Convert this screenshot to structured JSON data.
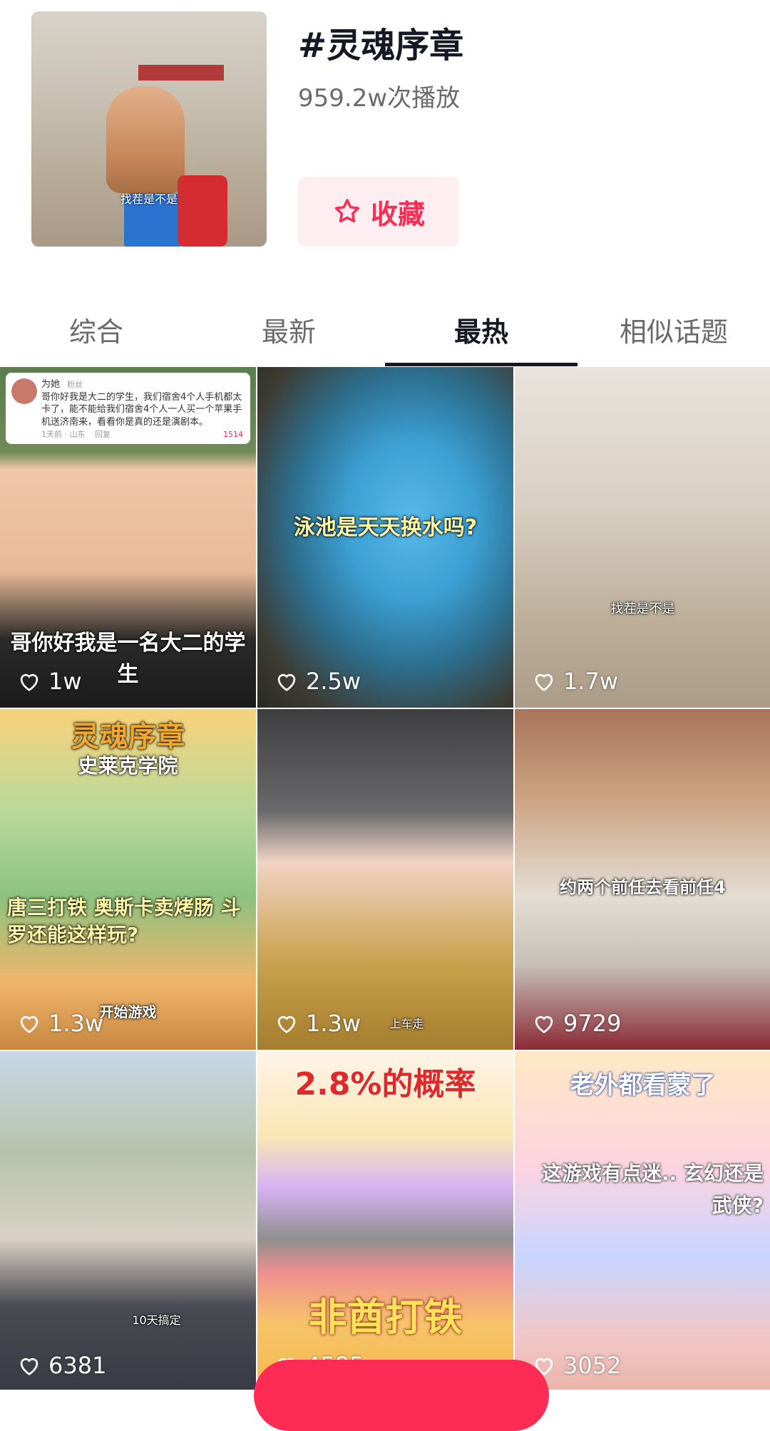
{
  "topic": {
    "title": "#灵魂序章",
    "play_count": "959.2w次播放",
    "cover_caption": "找茬是不是",
    "favorite_label": "收藏"
  },
  "tabs": [
    {
      "label": "综合",
      "active": false
    },
    {
      "label": "最新",
      "active": false
    },
    {
      "label": "最热",
      "active": true
    },
    {
      "label": "相似话题",
      "active": false
    }
  ],
  "videos": [
    {
      "likes": "1w",
      "caption": "哥你好我是一名大二的学生",
      "comment": {
        "user": "为她",
        "badge": "粉丝",
        "text": "哥你好我是大二的学生，我们宿舍4个人手机都太卡了，能不能给我们宿舍4个人一人买一个苹果手机送济南来，看看你是真的还是演剧本。",
        "time": "1天前 · 山东",
        "reply": "回复",
        "count": "1514"
      }
    },
    {
      "likes": "2.5w",
      "caption": "泳池是天天换水吗?"
    },
    {
      "likes": "1.7w",
      "caption": "找茬是不是"
    },
    {
      "likes": "1.3w",
      "caption": "唐三打铁 奥斯卡卖烤肠 斗罗还能这样玩?",
      "top_text": "灵魂序章",
      "sub_text": "史莱克学院",
      "button": "开始游戏"
    },
    {
      "likes": "1.3w",
      "caption": "上车走"
    },
    {
      "likes": "9729",
      "caption": "约两个前任去看前任4"
    },
    {
      "likes": "6381",
      "caption": "10天搞定"
    },
    {
      "likes": "4585",
      "caption": "非酋打铁",
      "top_text": "2.8%的概率"
    },
    {
      "likes": "3052",
      "caption": "这游戏有点迷.. 玄幻还是武侠?",
      "top_text": "老外都看蒙了"
    }
  ],
  "icons": {
    "favorite": "star-outline-icon",
    "like": "heart-outline-icon"
  },
  "colors": {
    "accent": "#fe2c55",
    "accent_bg": "#fdeef1",
    "text_primary": "#161823",
    "text_secondary": "#6b6b6b"
  }
}
